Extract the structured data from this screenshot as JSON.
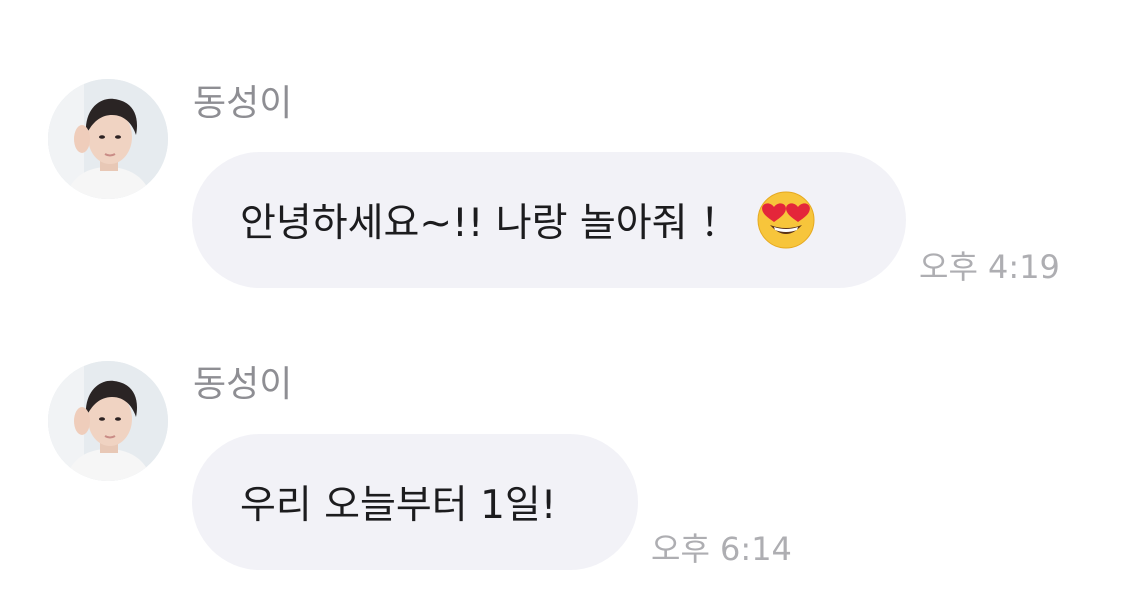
{
  "messages": [
    {
      "sender": "동성이",
      "text": "안녕하세요~!! 나랑 놀아줘 ！",
      "emoji": "smiling-face-with-heart-eyes",
      "time": "오후 4:19"
    },
    {
      "sender": "동성이",
      "text": "우리 오늘부터 1일!",
      "time": "오후 6:14"
    }
  ],
  "colors": {
    "bubble_bg": "#f2f2f7",
    "text": "#1c1c1e",
    "name": "#8e8e93",
    "timestamp": "#aeaeb2"
  }
}
